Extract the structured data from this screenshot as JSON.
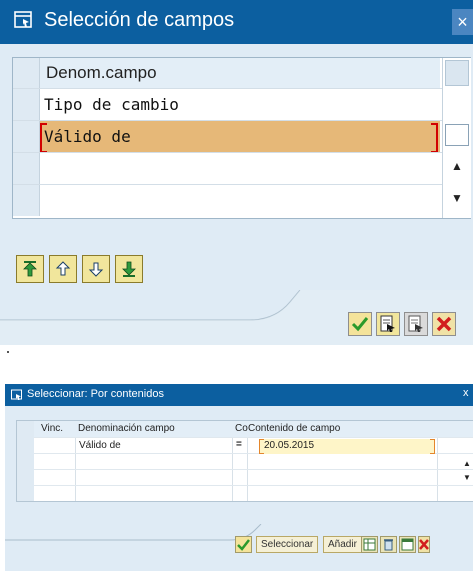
{
  "dialog1": {
    "title": "Selección de campos",
    "close": "×",
    "column_header": "Denom.campo",
    "rows": [
      "Tipo de cambio",
      "Válido de",
      "",
      ""
    ]
  },
  "dialog2": {
    "title": "Seleccionar: Por contenidos",
    "close": "x",
    "headers": {
      "link": "Vinc.",
      "field_name": "Denominación campo",
      "op": "Co",
      "content": "Contenido de campo"
    },
    "row": {
      "field_name": "Válido de",
      "op": "=",
      "value": "20.05.2015"
    },
    "buttons": {
      "select": "Seleccionar",
      "add": "Añadir"
    }
  },
  "icons": {
    "toolbar1": [
      "move-top-icon",
      "move-up-icon",
      "move-down-icon",
      "move-bottom-icon"
    ],
    "footer1": [
      "confirm-icon",
      "execute-icon",
      "execute-alt-icon",
      "cancel-icon"
    ]
  },
  "colors": {
    "titlebar": "#0c5fa0",
    "dialog_bg": "#dfebf5",
    "selected_row": "#e6b878",
    "focus_bracket": "#d20000",
    "input_bg": "#fef5c8"
  }
}
